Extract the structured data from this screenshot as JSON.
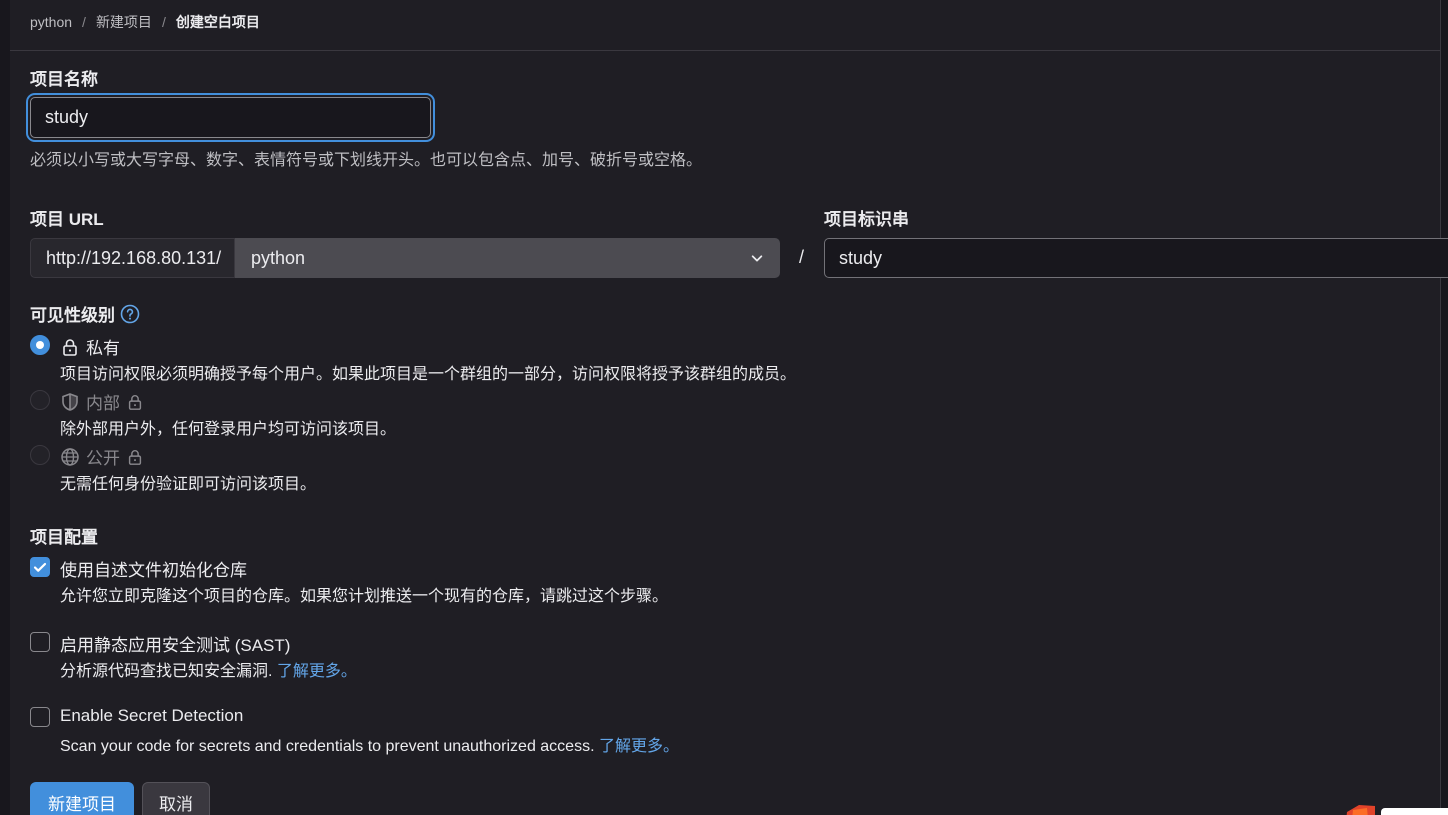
{
  "breadcrumb": {
    "items": [
      "python",
      "新建项目"
    ],
    "current": "创建空白项目",
    "separator": "/"
  },
  "project_name": {
    "label": "项目名称",
    "value": "study",
    "help": "必须以小写或大写字母、数字、表情符号或下划线开头。也可以包含点、加号、破折号或空格。"
  },
  "project_url": {
    "label": "项目 URL",
    "prefix": "http://192.168.80.131/",
    "namespace": "python",
    "separator": "/"
  },
  "project_slug": {
    "label": "项目标识串",
    "value": "study"
  },
  "visibility": {
    "label": "可见性级别",
    "options": [
      {
        "label": "私有",
        "description": "项目访问权限必须明确授予每个用户。如果此项目是一个群组的一部分，访问权限将授予该群组的成员。",
        "selected": true,
        "disabled": false,
        "icon": "lock-icon"
      },
      {
        "label": "内部",
        "description": "除外部用户外，任何登录用户均可访问该项目。",
        "selected": false,
        "disabled": true,
        "icon": "shield-icon"
      },
      {
        "label": "公开",
        "description": "无需任何身份验证即可访问该项目。",
        "selected": false,
        "disabled": true,
        "icon": "globe-icon"
      }
    ]
  },
  "config": {
    "label": "项目配置",
    "readme": {
      "label": "使用自述文件初始化仓库",
      "description": "允许您立即克隆这个项目的仓库。如果您计划推送一个现有的仓库，请跳过这个步骤。",
      "checked": true
    },
    "sast": {
      "label": "启用静态应用安全测试 (SAST)",
      "description": "分析源代码查找已知安全漏洞.",
      "link": "了解更多。",
      "checked": false
    },
    "secret": {
      "label": "Enable Secret Detection",
      "description": "Scan your code for secrets and credentials to prevent unauthorized access.",
      "link": "了解更多。",
      "checked": false
    }
  },
  "actions": {
    "create_label": "新建项目",
    "cancel_label": "取消"
  },
  "colors": {
    "accent": "#428fdc",
    "background": "#1f1e24",
    "link": "#63a6e9"
  }
}
